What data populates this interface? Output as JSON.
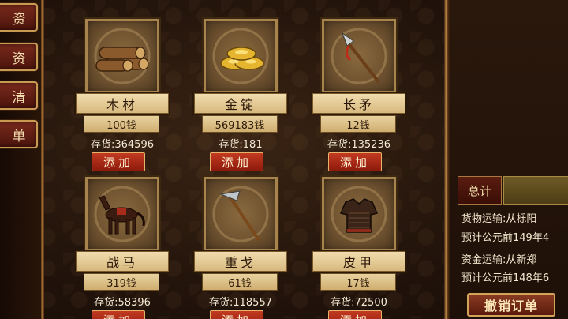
{
  "sidebar": {
    "tabs": [
      {
        "label": "资"
      },
      {
        "label": "资"
      },
      {
        "label": "清"
      },
      {
        "label": "单"
      }
    ]
  },
  "items": [
    {
      "name": "木材",
      "price": "100钱",
      "stock": "存货:364596",
      "add": "添加",
      "icon": "logs-icon"
    },
    {
      "name": "金锭",
      "price": "569183钱",
      "stock": "存货:181",
      "add": "添加",
      "icon": "gold-ingot-icon"
    },
    {
      "name": "长矛",
      "price": "12钱",
      "stock": "存货:135236",
      "add": "添加",
      "icon": "spear-icon"
    },
    {
      "name": "战马",
      "price": "319钱",
      "stock": "存货:58396",
      "add": "添加",
      "icon": "warhorse-icon"
    },
    {
      "name": "重戈",
      "price": "61钱",
      "stock": "存货:118557",
      "add": "添加",
      "icon": "halberd-icon"
    },
    {
      "name": "皮甲",
      "price": "17钱",
      "stock": "存货:72500",
      "add": "添加",
      "icon": "leather-armor-icon"
    }
  ],
  "summary": {
    "label": "总计",
    "lines": [
      "货物运输:从栎阳",
      "预计公元前149年4",
      "资金运输:从新郑",
      "预计公元前148年6"
    ],
    "cancel_label": "撤销订单"
  },
  "colors": {
    "add_button": "#b02e1a",
    "name_bar": "#e6cc94",
    "gold_trim": "#c99a52"
  }
}
